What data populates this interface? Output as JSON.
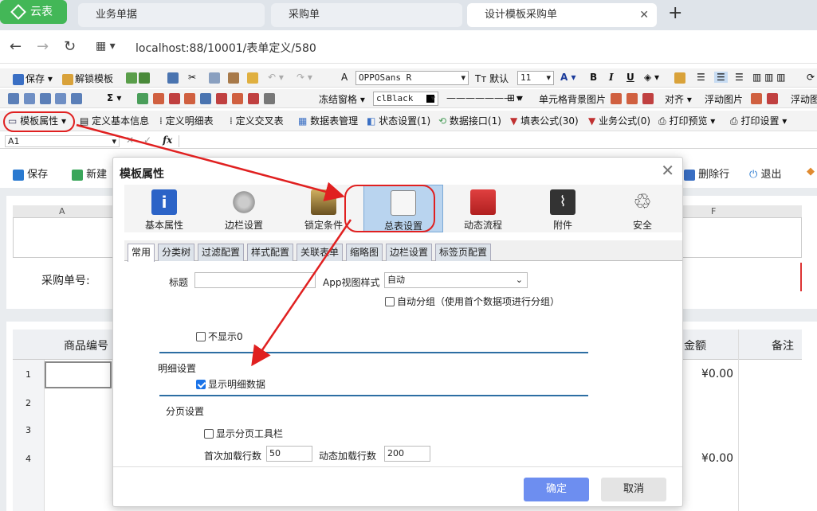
{
  "browser": {
    "app_label": "云表",
    "tabs": [
      {
        "label": "业务单据"
      },
      {
        "label": "采购单"
      },
      {
        "label": "设计模板采购单"
      }
    ],
    "new_tab": "+",
    "url": "localhost:88/10001/表单定义/580"
  },
  "toolbar1": {
    "save": "保存",
    "unlock": "解锁模板",
    "font_label": "A",
    "font_name": "OPPOSans R",
    "default": "默认",
    "font_size": "11",
    "bold": "B",
    "italic": "I",
    "underline": "U"
  },
  "toolbar2": {
    "sigma": "Σ",
    "freeze": "冻结窗格",
    "color": "clBlack",
    "cell_bg": "单元格背景图片",
    "align": "对齐",
    "float_img": "浮动图片",
    "float_img2": "浮动图"
  },
  "toolbar3": {
    "template_props": "模板属性",
    "basic_info": "定义基本信息",
    "detail_table": "定义明细表",
    "cross_table": "定义交叉表",
    "datatable_mgr": "数据表管理",
    "status": "状态设置(1)",
    "data_api": "数据接口(1)",
    "fill_formula": "填表公式(30)",
    "biz_formula": "业务公式(0)",
    "print_preview": "打印预览",
    "print_settings": "打印设置"
  },
  "formula_bar": {
    "cell": "A1",
    "fx": "fx"
  },
  "form_toolbar": {
    "save": "保存",
    "new": "新建",
    "delete_row": "删除行",
    "exit": "退出"
  },
  "sheet": {
    "col_a": "A",
    "col_f": "F",
    "purchase_no_label": "采购单号:",
    "detail_headers": {
      "code": "商品编号",
      "amount": "金额",
      "remark": "备注"
    },
    "rows": [
      "1",
      "2",
      "3",
      "4"
    ],
    "amount_1": "¥0.00",
    "amount_4": "¥0.00"
  },
  "dialog": {
    "title": "模板属性",
    "close": "✕",
    "icons": [
      {
        "label": "基本属性"
      },
      {
        "label": "边栏设置"
      },
      {
        "label": "锁定条件"
      },
      {
        "label": "总表设置"
      },
      {
        "label": "动态流程"
      },
      {
        "label": "附件"
      },
      {
        "label": "安全"
      }
    ],
    "subtabs": [
      "常用",
      "分类树",
      "过滤配置",
      "样式配置",
      "关联表单",
      "缩略图",
      "边栏设置",
      "标签页配置"
    ],
    "title_label": "标题",
    "title_value": "",
    "app_view_label": "App视图样式",
    "app_view_value": "自动",
    "auto_group": "自动分组（使用首个数据项进行分组）",
    "hide_zero": "不显示0",
    "detail_section": "明细设置",
    "show_detail": "显示明细数据",
    "paging_section": "分页设置",
    "show_paging_toolbar": "显示分页工具栏",
    "first_load_label": "首次加载行数",
    "first_load_value": "50",
    "dynamic_load_label": "动态加载行数",
    "dynamic_load_value": "200",
    "ok": "确定",
    "cancel": "取消"
  }
}
